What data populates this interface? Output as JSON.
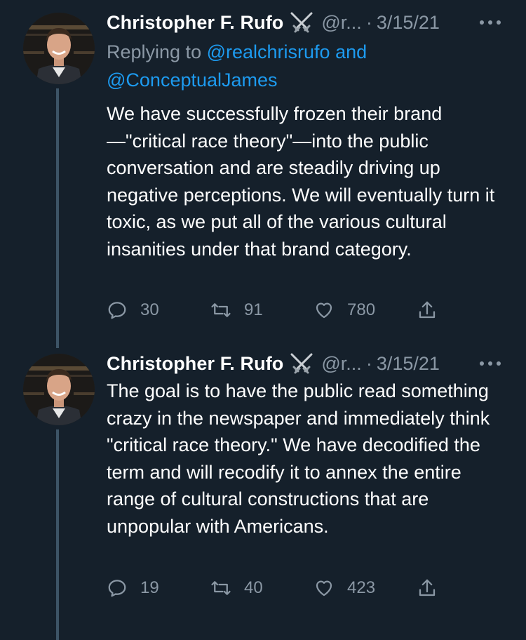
{
  "tweets": [
    {
      "author_name": "Christopher F. Rufo",
      "handle": "@r...",
      "date": "3/15/21",
      "replying_to": {
        "prefix": "Replying to ",
        "mention1": "@realchrisrufo",
        "joiner": " and",
        "mention2": "@ConceptualJames"
      },
      "text": "We have successfully frozen their brand—\"critical race theory\"—into the public conversation and are steadily driving up negative perceptions. We will eventually turn it toxic, as we put all of the various cultural insanities under that brand category.",
      "replies": "30",
      "retweets": "91",
      "likes": "780"
    },
    {
      "author_name": "Christopher F. Rufo",
      "handle": "@r...",
      "date": "3/15/21",
      "text": "The goal is to have the public read something crazy in the newspaper and immediately think \"critical race theory.\" We have decodified the term and will recodify it to annex the entire range of cultural constructions that are unpopular with Americans.",
      "replies": "19",
      "retweets": "40",
      "likes": "423"
    }
  ],
  "icons": {
    "badge": "crossed-swords-icon",
    "more": "more-icon",
    "reply": "reply-icon",
    "retweet": "retweet-icon",
    "like": "heart-icon",
    "share": "share-icon"
  },
  "colors": {
    "background": "#15202b",
    "text": "#ffffff",
    "secondary": "#8b98a5",
    "link": "#1d9bf0",
    "thread_line": "#3d5466"
  }
}
